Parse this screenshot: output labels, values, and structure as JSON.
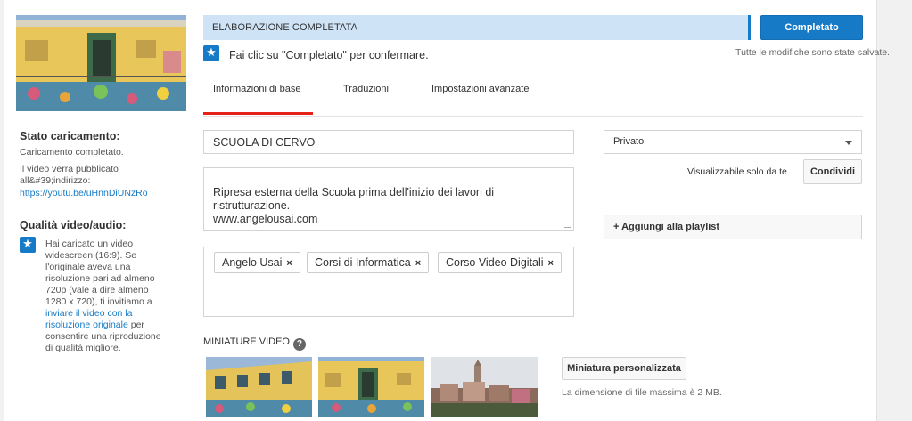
{
  "sidebar": {
    "upload_status_title": "Stato caricamento:",
    "upload_status_text": "Caricamento completato.",
    "publish_note": "Il video verrà pubblicato all&#39;indirizzo:",
    "publish_url": "https://youtu.be/uHnnDiUNzRo",
    "quality_title": "Qualità video/audio:",
    "quality_text_1": "Hai caricato un video widescreen (16:9). Se l'originale aveva una risoluzione pari ad almeno 720p (vale a dire almeno 1280 x 720), ti invitiamo a ",
    "quality_link": "inviare il video con la risoluzione originale",
    "quality_text_2": " per consentire una riproduzione di qualità migliore."
  },
  "header": {
    "status": "ELABORAZIONE COMPLETATA",
    "done_button": "Completato",
    "confirm_text": "Fai clic su \"Completato\" per confermare.",
    "saved_text": "Tutte le modifiche sono state salvate."
  },
  "tabs": [
    {
      "label": "Informazioni di base",
      "active": true
    },
    {
      "label": "Traduzioni",
      "active": false
    },
    {
      "label": "Impostazioni avanzate",
      "active": false
    }
  ],
  "form": {
    "title_value": "SCUOLA DI CERVO",
    "description_value": "Ripresa esterna della Scuola prima dell'inizio dei lavori di ristrutturazione.\nwww.angelousai.com",
    "tags": [
      "Angelo Usai",
      "Corsi di Informatica",
      "Corso Video Digitali"
    ],
    "tag_remove_symbol": "×"
  },
  "privacy": {
    "selected": "Privato",
    "visibility_note": "Visualizzabile solo da te",
    "share_button": "Condividi",
    "playlist_button": "+ Aggiungi alla playlist"
  },
  "thumbnails": {
    "title": "MINIATURE VIDEO",
    "help_symbol": "?",
    "custom_button": "Miniatura personalizzata",
    "max_size_note": "La dimensione di file massima è 2 MB."
  },
  "colors": {
    "accent": "#167ac6",
    "tab_active": "#e62117",
    "status_bar": "#cfe3f7"
  }
}
